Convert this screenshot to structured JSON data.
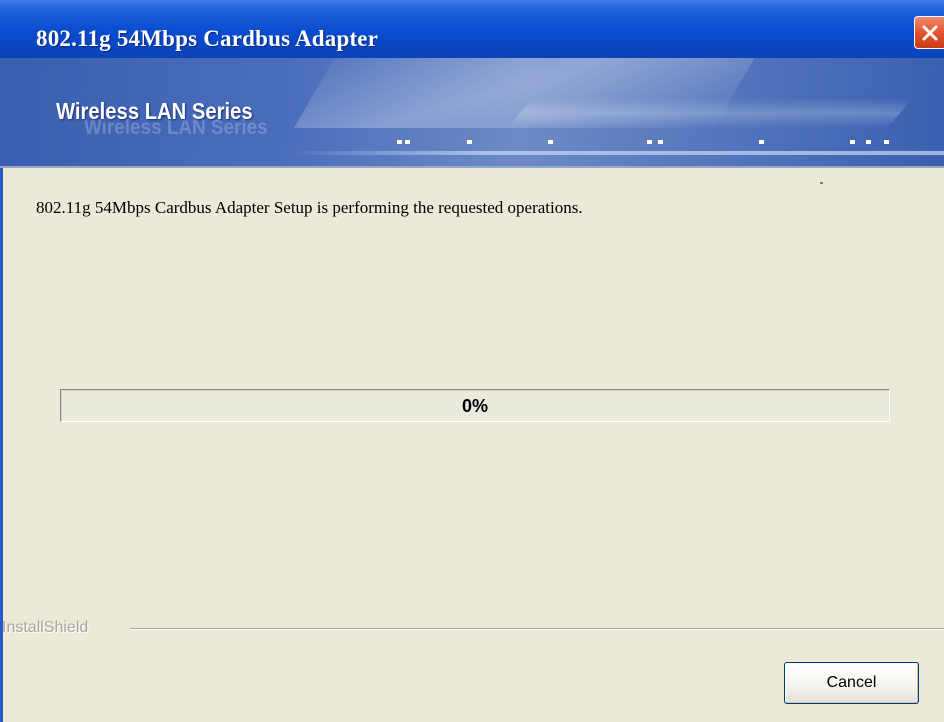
{
  "window": {
    "title": "802.11g 54Mbps Cardbus Adapter",
    "close_icon": "close-icon"
  },
  "banner": {
    "brand": "Wireless LAN Series",
    "brand_reflection": "Wireless LAN Series"
  },
  "main": {
    "message": "802.11g 54Mbps Cardbus Adapter Setup is performing the requested operations."
  },
  "progress": {
    "value_text": "0%",
    "fraction": 0
  },
  "footer": {
    "installshield_label": "InstallShield",
    "cancel_label": "Cancel"
  },
  "colors": {
    "titlebar": "#0a4bd0",
    "banner": "#4a6dbb",
    "dialog_bg": "#ece9d8",
    "close_button": "#e2542e"
  }
}
